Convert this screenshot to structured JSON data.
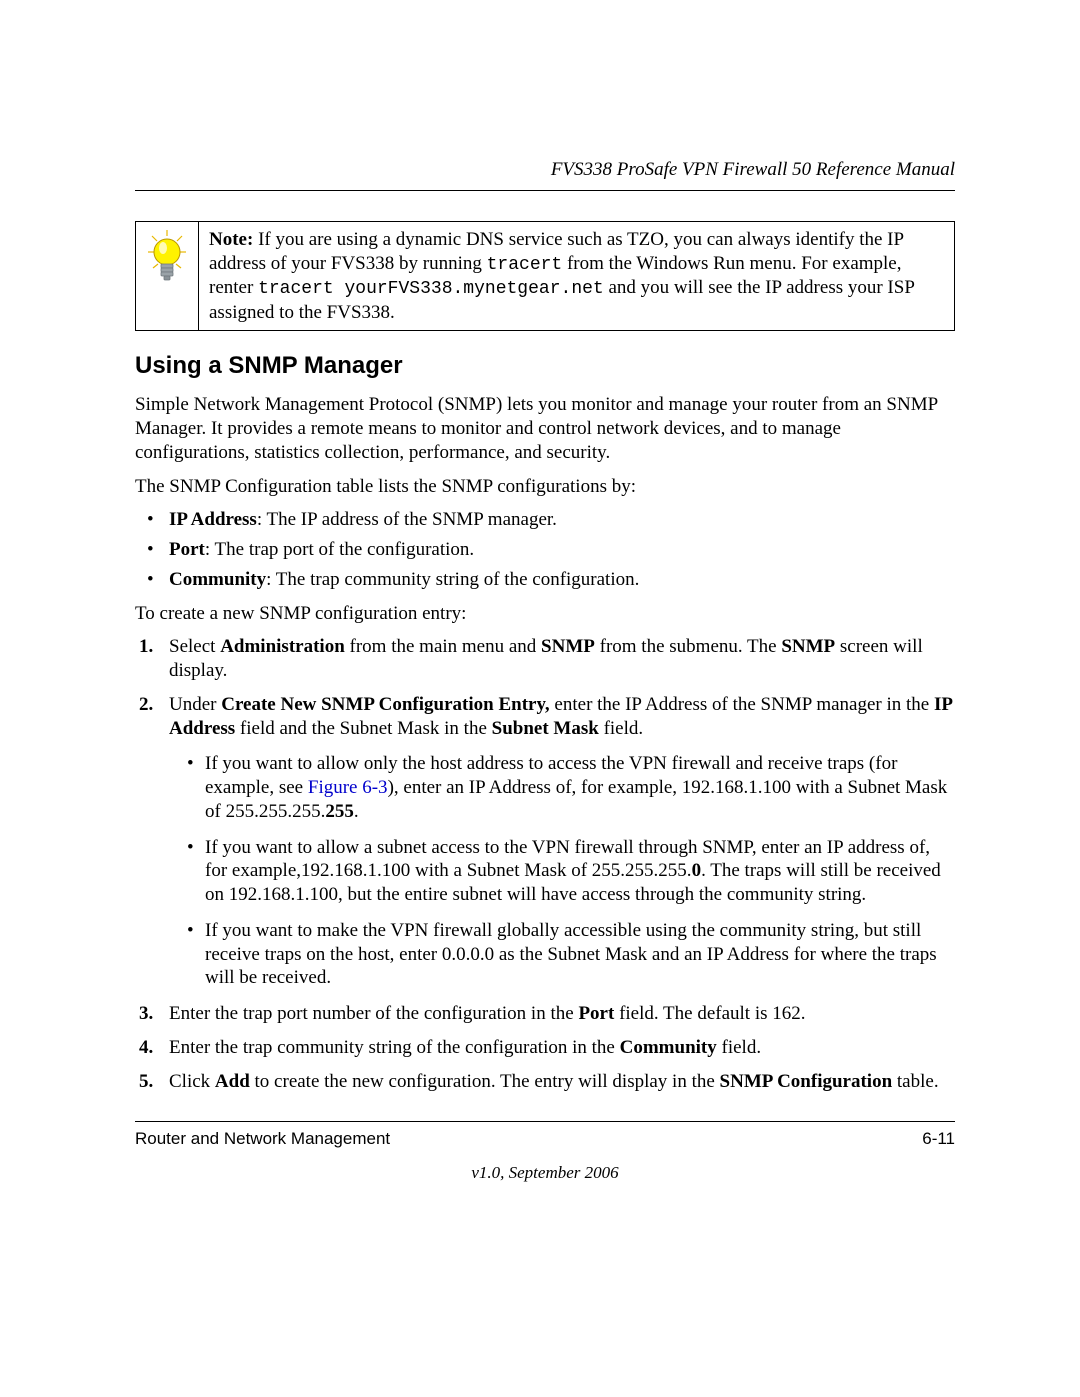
{
  "header": {
    "running_title": "FVS338 ProSafe VPN Firewall 50 Reference Manual"
  },
  "note": {
    "label": "Note:",
    "line1_after_label": " If you are using a dynamic DNS service such as TZO, you can always identify the IP address of your FVS338 by running ",
    "code1": "tracert",
    "line1_end": " from the Windows Run menu. For example, renter ",
    "code2": "tracert yourFVS338.mynetgear.net",
    "line2": " and you will see the IP address your ISP assigned to the FVS338."
  },
  "section_title": "Using a SNMP Manager",
  "intro1": "Simple Network Management Protocol (SNMP) lets you monitor and manage your router from an SNMP Manager. It provides a remote means to monitor and control network devices, and to manage configurations, statistics collection, performance, and security.",
  "intro2": "The SNMP Configuration table lists the SNMP configurations by:",
  "config_list": [
    {
      "bold": "IP Address",
      "rest": ": The IP address of the SNMP manager."
    },
    {
      "bold": "Port",
      "rest": ": The trap port of the configuration."
    },
    {
      "bold": "Community",
      "rest": ": The trap community string of the configuration."
    }
  ],
  "steps_intro": "To create a new SNMP configuration entry:",
  "step1": {
    "pre": "Select ",
    "b1": "Administration",
    "mid1": " from the main menu and ",
    "b2": "SNMP",
    "mid2": " from the submenu. The ",
    "b3": "SNMP",
    "end": " screen will display."
  },
  "step2": {
    "pre": "Under ",
    "b1": "Create New SNMP Configuration Entry,",
    "mid1": " enter the IP Address of the SNMP manager in the ",
    "b2": "IP Address",
    "mid2": " field and the Subnet Mask in the ",
    "b3": "Subnet Mask",
    "end": " field."
  },
  "sub1": {
    "pre": "If you want to allow only the host address to access the VPN firewall and receive traps (for example, see ",
    "xref": "Figure 6-3",
    "mid": "), enter an IP Address of, for example, 192.168.1.100 with a Subnet Mask of 255.255.255.",
    "bold": "255",
    "end": "."
  },
  "sub2": {
    "pre": "If you want to allow a subnet access to the VPN firewall through SNMP, enter an IP address of, for example,192.168.1.100 with a Subnet Mask of 255.255.255.",
    "bold": "0",
    "end": ". The traps will still be received on 192.168.1.100, but the entire subnet will have access through the community string."
  },
  "sub3": "If you want to make the VPN firewall globally accessible using the community string, but still receive traps on the host, enter 0.0.0.0 as the Subnet Mask and an IP Address for where the traps will be received.",
  "step3": {
    "pre": "Enter the trap port number of the configuration in the ",
    "b1": "Port",
    "end": " field. The default is 162."
  },
  "step4": {
    "pre": "Enter the trap community string of the configuration in the ",
    "b1": "Community",
    "end": " field."
  },
  "step5": {
    "pre": "Click ",
    "b1": "Add",
    "mid": " to create the new configuration. The entry will display in the ",
    "b2": "SNMP Configuration",
    "end": " table."
  },
  "footer": {
    "left": "Router and Network Management",
    "right": "6-11",
    "version": "v1.0, September 2006"
  }
}
